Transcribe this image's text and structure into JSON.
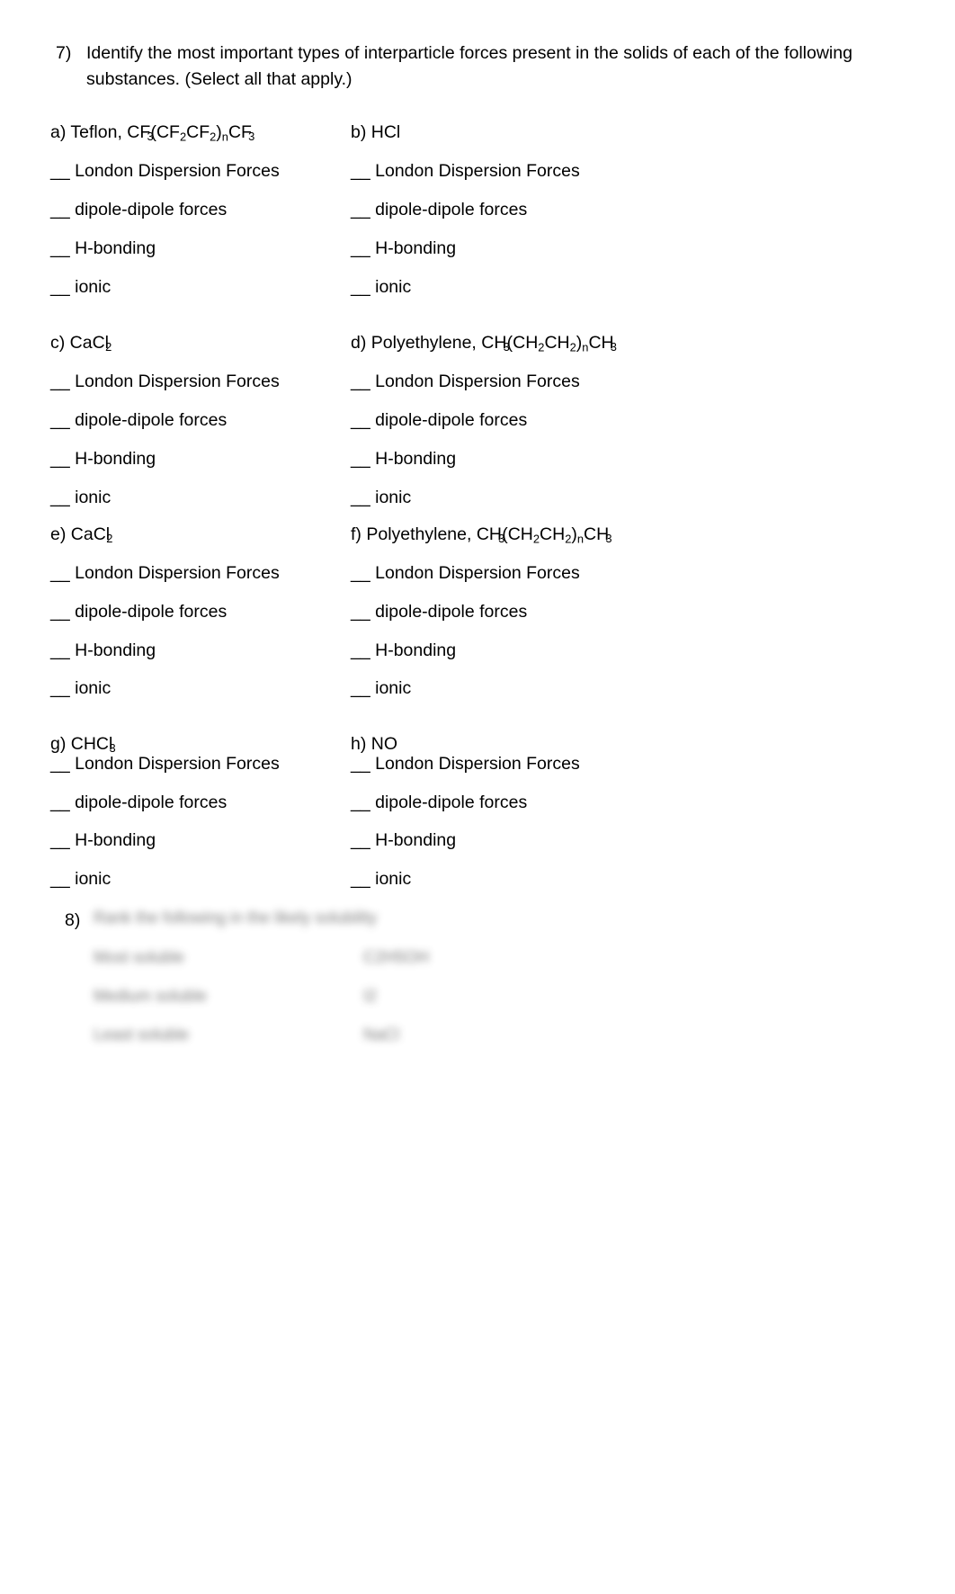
{
  "document": {
    "background_color": "#ffffff",
    "text_color": "#000000"
  },
  "question7": {
    "number": "7)",
    "line1": "Identify the most important types of interparticle forces present in the solids of each of the following",
    "line2": "substances. (Select all that apply.)"
  },
  "choice_labels": {
    "blank": "__",
    "london": "London Dispersion Forces",
    "dipole": "dipole-dipole forces",
    "hbonding": "H-bonding",
    "ionic": "ionic"
  },
  "subquestions": [
    {
      "id": "a",
      "marker": "a)",
      "name": "Teflon,",
      "formula_parts": [
        "CF",
        "3",
        "(CF",
        "2",
        "CF",
        "2",
        ")",
        "n",
        "CF",
        "3"
      ],
      "formula_plain": "CF3(CF2CF2)nCF3"
    },
    {
      "id": "b",
      "marker": "b)",
      "name": "HCl",
      "formula_parts": [],
      "formula_plain": ""
    },
    {
      "id": "c",
      "marker": "c)",
      "name": "CaCl",
      "formula_parts": [
        "CaCl",
        "2"
      ],
      "formula_plain": "CaCl2"
    },
    {
      "id": "d",
      "marker": "d)",
      "name": "Polyethylene,",
      "formula_parts": [
        "CH",
        "3",
        "(CH",
        "2",
        "CH",
        "2",
        ")",
        "n",
        "CH",
        "3"
      ],
      "formula_plain": "CH3(CH2CH2)nCH3"
    },
    {
      "id": "e",
      "marker": "e)",
      "name": "CaCl",
      "formula_parts": [
        "CaCl",
        "2"
      ],
      "formula_plain": "CaCl2"
    },
    {
      "id": "f",
      "marker": "f)",
      "name": "Polyethylene,",
      "formula_parts": [
        "CH",
        "3",
        "(CH",
        "2",
        "CH",
        "2",
        ")",
        "n",
        "CH",
        "3"
      ],
      "formula_plain": "CH3(CH2CH2)nCH3"
    },
    {
      "id": "g",
      "marker": "g)",
      "name": "CHCl",
      "formula_parts": [
        "CHCl",
        "3"
      ],
      "formula_plain": "CHCl3"
    },
    {
      "id": "h",
      "marker": "h)",
      "name": "NO",
      "formula_parts": [],
      "formula_plain": ""
    }
  ],
  "question8": {
    "number": "8)",
    "prompt_blurred": "Rank the following in the likely solubility",
    "rows": [
      {
        "left": "Most soluble",
        "right": "C2H5OH"
      },
      {
        "left": "Medium soluble",
        "right": "I2"
      },
      {
        "left": "Least soluble",
        "right": "NaCl"
      }
    ],
    "is_blurred": true
  }
}
